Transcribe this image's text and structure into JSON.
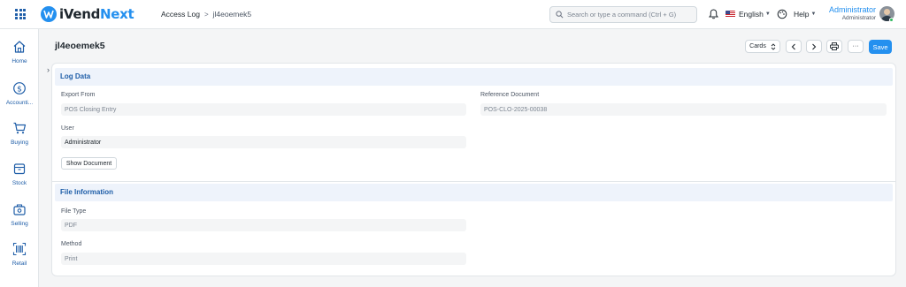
{
  "app": {
    "brand_part1": "iVend",
    "brand_part2": "Next",
    "accent_color": "#2490ef"
  },
  "breadcrumb": {
    "parent": "Access Log",
    "separator": ">",
    "current": "jl4eoemek5"
  },
  "search": {
    "placeholder": "Search or type a command (Ctrl + G)"
  },
  "navbar": {
    "language": "English",
    "help": "Help",
    "user_name": "Administrator",
    "user_role": "Administrator"
  },
  "sidebar": {
    "items": [
      {
        "label": "Home",
        "icon": "home-icon"
      },
      {
        "label": "Accounti...",
        "icon": "dollar-icon"
      },
      {
        "label": "Buying",
        "icon": "cart-icon"
      },
      {
        "label": "Stock",
        "icon": "box-icon"
      },
      {
        "label": "Selling",
        "icon": "bag-icon"
      },
      {
        "label": "Retail",
        "icon": "barcode-icon"
      }
    ]
  },
  "page": {
    "title": "jl4eoemek5",
    "view_select": "Cards",
    "more_label": "···",
    "save_label": "Save"
  },
  "sections": {
    "log_data": {
      "title": "Log Data",
      "export_from_label": "Export From",
      "export_from_value": "POS Closing Entry",
      "reference_label": "Reference Document",
      "reference_value": "POS-CLO-2025-00038",
      "user_label": "User",
      "user_value": "Administrator",
      "show_document_label": "Show Document"
    },
    "file_info": {
      "title": "File Information",
      "file_type_label": "File Type",
      "file_type_value": "PDF",
      "method_label": "Method",
      "method_value": "Print"
    }
  }
}
